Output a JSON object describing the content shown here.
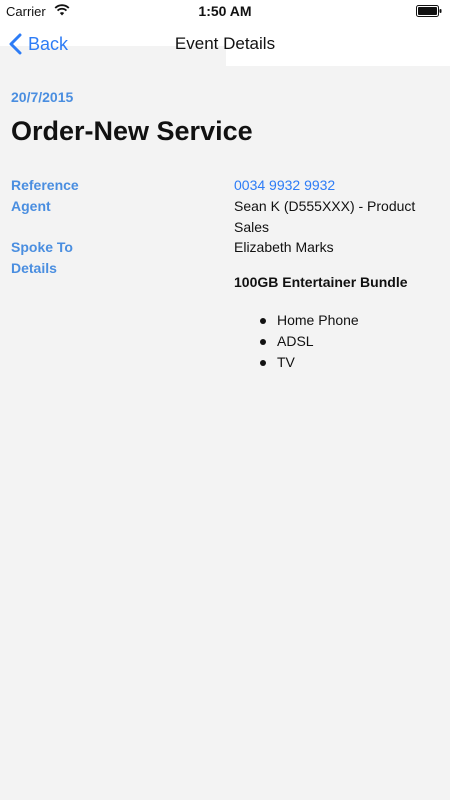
{
  "status_bar": {
    "carrier": "Carrier",
    "time": "1:50 AM"
  },
  "nav": {
    "back_label": "Back",
    "title": "Event Details"
  },
  "event": {
    "date": "20/7/2015",
    "title": "Order-New Service",
    "fields": {
      "reference_label": "Reference",
      "reference_value": "0034 9932 9932",
      "agent_label": "Agent",
      "agent_value": "Sean K (D555XXX) - Product Sales",
      "spoke_to_label": "Spoke To",
      "spoke_to_value": "Elizabeth Marks",
      "details_label": "Details"
    },
    "details": {
      "bundle_title": "100GB Entertainer Bundle",
      "items": [
        "Home Phone",
        "ADSL",
        "TV"
      ]
    }
  },
  "colors": {
    "accent": "#2d7cf6",
    "label_blue": "#4a8ee0",
    "background": "#f3f3f3"
  }
}
